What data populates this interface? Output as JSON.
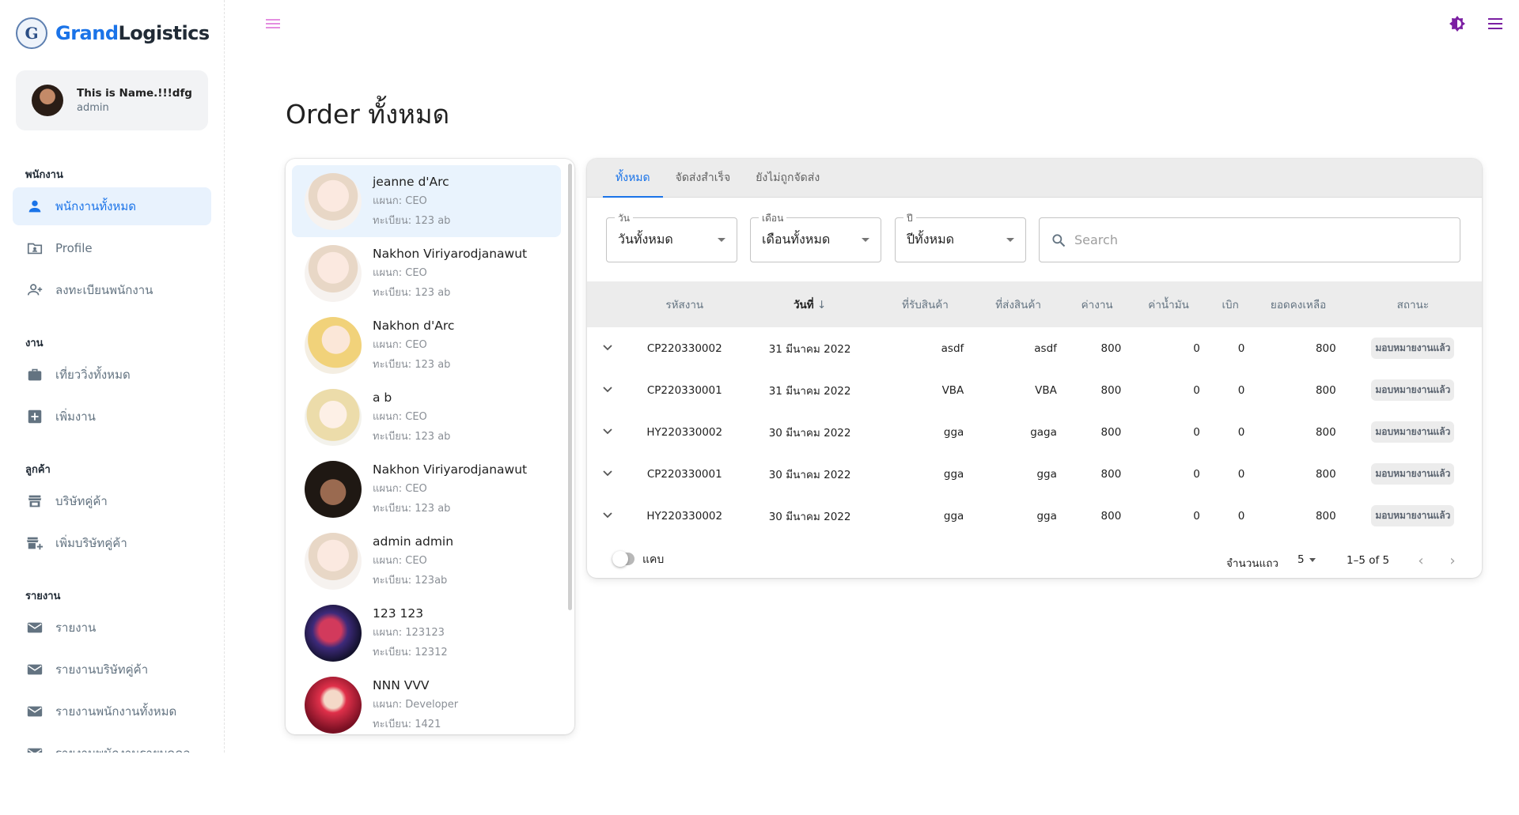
{
  "brand": {
    "name_part1": "Grand",
    "name_part2": "Logistics",
    "logo_letter": "G"
  },
  "user": {
    "name": "This is Name.!!!dfgsdfg...",
    "role": "admin"
  },
  "nav": {
    "section_employees": "พนักงาน",
    "all_employees": "พนักงานทั้งหมด",
    "profile": "Profile",
    "register_employee": "ลงทะเบียนพนักงาน",
    "section_work": "งาน",
    "all_trips": "เที่ยววิ่งทั้งหมด",
    "add_work": "เพิ่มงาน",
    "section_customers": "ลูกค้า",
    "partner_companies": "บริษัทคู่ค้า",
    "add_partner": "เพิ่มบริษัทคู่ค้า",
    "section_reports": "รายงาน",
    "reports": "รายงาน",
    "partner_reports": "รายงานบริษัทคู่ค้า",
    "all_employee_reports": "รายงานพนักงานทั้งหมด",
    "individual_employee_reports": "รายงานพนักงานรายบุคคล"
  },
  "page": {
    "title": "Order ทั้งหมด"
  },
  "employees": [
    {
      "name": "jeanne d'Arc",
      "dept": "แผนก: CEO",
      "reg": "ทะเบียน: 123 ab"
    },
    {
      "name": "Nakhon Viriyarodjanawut",
      "dept": "แผนก: CEO",
      "reg": "ทะเบียน: 123 ab"
    },
    {
      "name": "Nakhon d'Arc",
      "dept": "แผนก: CEO",
      "reg": "ทะเบียน: 123 ab"
    },
    {
      "name": "a b",
      "dept": "แผนก: CEO",
      "reg": "ทะเบียน: 123 ab"
    },
    {
      "name": "Nakhon Viriyarodjanawut",
      "dept": "แผนก: CEO",
      "reg": "ทะเบียน: 123 ab"
    },
    {
      "name": "admin admin",
      "dept": "แผนก: CEO",
      "reg": "ทะเบียน: 123ab"
    },
    {
      "name": "123 123",
      "dept": "แผนก: 123123",
      "reg": "ทะเบียน: 12312"
    },
    {
      "name": "NNN VVV",
      "dept": "แผนก: Developer",
      "reg": "ทะเบียน: 1421"
    }
  ],
  "tabs": [
    "ทั้งหมด",
    "จัดส่งสำเร็จ",
    "ยังไม่ถูกจัดส่ง"
  ],
  "filters": {
    "day_label": "วัน",
    "day_value": "วันทั้งหมด",
    "month_label": "เดือน",
    "month_value": "เดือนทั้งหมด",
    "year_label": "ปี",
    "year_value": "ปีทั้งหมด",
    "search_placeholder": "Search"
  },
  "table": {
    "headers": [
      "รหัสงาน",
      "วันที่",
      "ที่รับสินค้า",
      "ที่ส่งสินค้า",
      "ค่างาน",
      "ค่าน้ำมัน",
      "เบิก",
      "ยอดคงเหลือ",
      "สถานะ"
    ],
    "rows": [
      [
        "CP220330002",
        "31 มีนาคม 2022",
        "asdf",
        "asdf",
        "800",
        "0",
        "0",
        "800",
        "มอบหมายงานแล้ว"
      ],
      [
        "CP220330001",
        "31 มีนาคม 2022",
        "VBA",
        "VBA",
        "800",
        "0",
        "0",
        "800",
        "มอบหมายงานแล้ว"
      ],
      [
        "HY220330002",
        "30 มีนาคม 2022",
        "gga",
        "gaga",
        "800",
        "0",
        "0",
        "800",
        "มอบหมายงานแล้ว"
      ],
      [
        "CP220330001",
        "30 มีนาคม 2022",
        "gga",
        "gga",
        "800",
        "0",
        "0",
        "800",
        "มอบหมายงานแล้ว"
      ],
      [
        "HY220330002",
        "30 มีนาคม 2022",
        "gga",
        "gga",
        "800",
        "0",
        "0",
        "800",
        "มอบหมายงานแล้ว"
      ]
    ]
  },
  "footer": {
    "dense_label": "แคบ",
    "rows_per_page_label": "จำนวนแถว",
    "rows_per_page": "5",
    "range": "1–5 of 5"
  },
  "colors": {
    "accent": "#1a73e8",
    "active_bg": "#e8f2fd",
    "theme_icon": "#7b1fa2",
    "menu_icon_light": "#e48ee0"
  }
}
